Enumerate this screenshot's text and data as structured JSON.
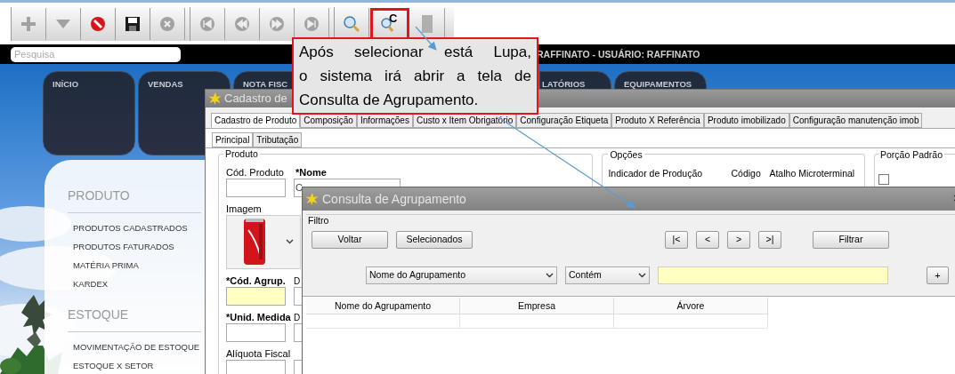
{
  "toolbar": {
    "groups": [
      {
        "buttons": [
          {
            "kind": "plus",
            "disabled": true,
            "highlighted": false
          },
          {
            "kind": "dropdown",
            "disabled": true,
            "highlighted": false
          },
          {
            "kind": "stop",
            "disabled": false,
            "highlighted": false
          },
          {
            "kind": "save",
            "disabled": false,
            "highlighted": false
          },
          {
            "kind": "cancel",
            "disabled": true,
            "highlighted": false
          }
        ]
      },
      {
        "buttons": [
          {
            "kind": "first",
            "disabled": true,
            "highlighted": false
          },
          {
            "kind": "previous",
            "disabled": true,
            "highlighted": false
          },
          {
            "kind": "next",
            "disabled": true,
            "highlighted": false
          },
          {
            "kind": "last",
            "disabled": true,
            "highlighted": false
          }
        ]
      },
      {
        "buttons": [
          {
            "kind": "search",
            "disabled": false,
            "highlighted": false
          },
          {
            "kind": "search_c",
            "label": "C",
            "disabled": false,
            "highlighted": true
          },
          {
            "kind": "report",
            "disabled": true,
            "highlighted": false
          }
        ]
      }
    ]
  },
  "search": {
    "placeholder": "Pesquisa"
  },
  "user_info": "RAFFINATO - USUÁRIO: RAFFINATO",
  "nav_tabs": [
    {
      "label": "INÍCIO"
    },
    {
      "label": "VENDAS"
    },
    {
      "label": "NOTA FISC"
    },
    {
      "label": "LATÓRIOS"
    },
    {
      "label": "EQUIPAMENTOS"
    }
  ],
  "sidebar": {
    "sections": [
      {
        "title": "PRODUTO",
        "items": [
          "PRODUTOS CADASTRADOS",
          "PRODUTOS FATURADOS",
          "MATÉRIA PRIMA",
          "KARDEX"
        ]
      },
      {
        "title": "ESTOQUE",
        "items": [
          "MOVIMENTAÇÃO DE ESTOQUE",
          "ESTOQUE X SETOR"
        ]
      }
    ]
  },
  "cadastro_window": {
    "title": "Cadastro de",
    "tabs": [
      {
        "label": "Cadastro de Produto",
        "selected": true
      },
      {
        "label": "Composição",
        "selected": false
      },
      {
        "label": "Informações",
        "selected": false
      },
      {
        "label": "Custo x Item Obrigatório",
        "selected": false
      },
      {
        "label": "Configuração Etiqueta",
        "selected": false
      },
      {
        "label": "Produto X Referência",
        "selected": false
      },
      {
        "label": "Produto imobilizado",
        "selected": false
      },
      {
        "label": "Configuração manutenção imob",
        "selected": false
      }
    ],
    "subtabs": [
      {
        "label": "Principal",
        "selected": true
      },
      {
        "label": "Tributação",
        "selected": false
      }
    ],
    "produto": {
      "title": "Produto",
      "cod_produto": {
        "label": "Cód. Produto",
        "required": false
      },
      "nome": {
        "label": "*Nome",
        "required": true,
        "value": "C"
      },
      "imagem": {
        "label": "Imagem"
      },
      "cod_agrup": {
        "label": "*Cód. Agrup.",
        "required": true,
        "focused": true,
        "fragment": "D"
      },
      "unid_medida": {
        "label": "*Unid. Medida",
        "required": true,
        "focused": false,
        "fragment": "D"
      },
      "aliquota": {
        "label": "Alíquota Fiscal",
        "required": false
      }
    },
    "opcoes": {
      "title": "Opções",
      "columns": [
        "Indicador de Produção",
        "Código",
        "Atalho Microterminal"
      ]
    },
    "porcao": {
      "title": "Porção Padrão",
      "checked": false
    }
  },
  "consulta_window": {
    "title": "Consulta de Agrupamento",
    "filter_title": "Filtro",
    "left_buttons": [
      "Voltar",
      "Selecionados"
    ],
    "nav_buttons": [
      "|<",
      "<",
      ">",
      ">|"
    ],
    "filter_button": "Filtrar",
    "field_select": "Nome do Agrupamento",
    "operator_select": "Contém",
    "search": {
      "focused": true
    },
    "add_button": "+",
    "columns": [
      "Nome do Agrupamento",
      "Empresa",
      "Árvore"
    ]
  },
  "callout": {
    "lines": [
      "Após selecionar está Lupa,",
      "o sistema irá abrir a tela de",
      "Consulta de Agrupamento."
    ]
  }
}
